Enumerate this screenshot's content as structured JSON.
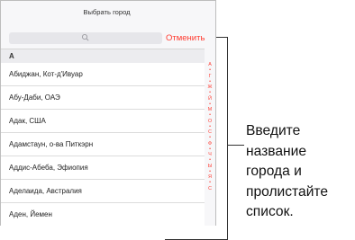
{
  "header": {
    "title": "Выбрать город"
  },
  "search": {
    "cancel_label": "Отменить"
  },
  "section": {
    "letter": "А"
  },
  "cities": [
    "Абиджан, Кот-д'Ивуар",
    "Абу-Даби, ОАЭ",
    "Адак, США",
    "Адамстаун, о-ва Питкэрн",
    "Аддис-Абеба, Эфиопия",
    "Аделаида, Австралия",
    "Аден, Йемен"
  ],
  "index": [
    "А",
    "•",
    "Г",
    "•",
    "Ж",
    "•",
    "Й",
    "•",
    "М",
    "•",
    "О",
    "•",
    "С",
    "•",
    "Ф",
    "•",
    "Ч",
    "•",
    "Ы",
    "•",
    "Я",
    "•",
    "С"
  ],
  "callout": {
    "line1": "Введите",
    "line2": "название",
    "line3": "города и",
    "line4": "пролистайте",
    "line5": "список."
  },
  "colors": {
    "accent": "#ff3b30",
    "background": "#f7f7f9"
  },
  "icons": {
    "search": "magnifier"
  }
}
